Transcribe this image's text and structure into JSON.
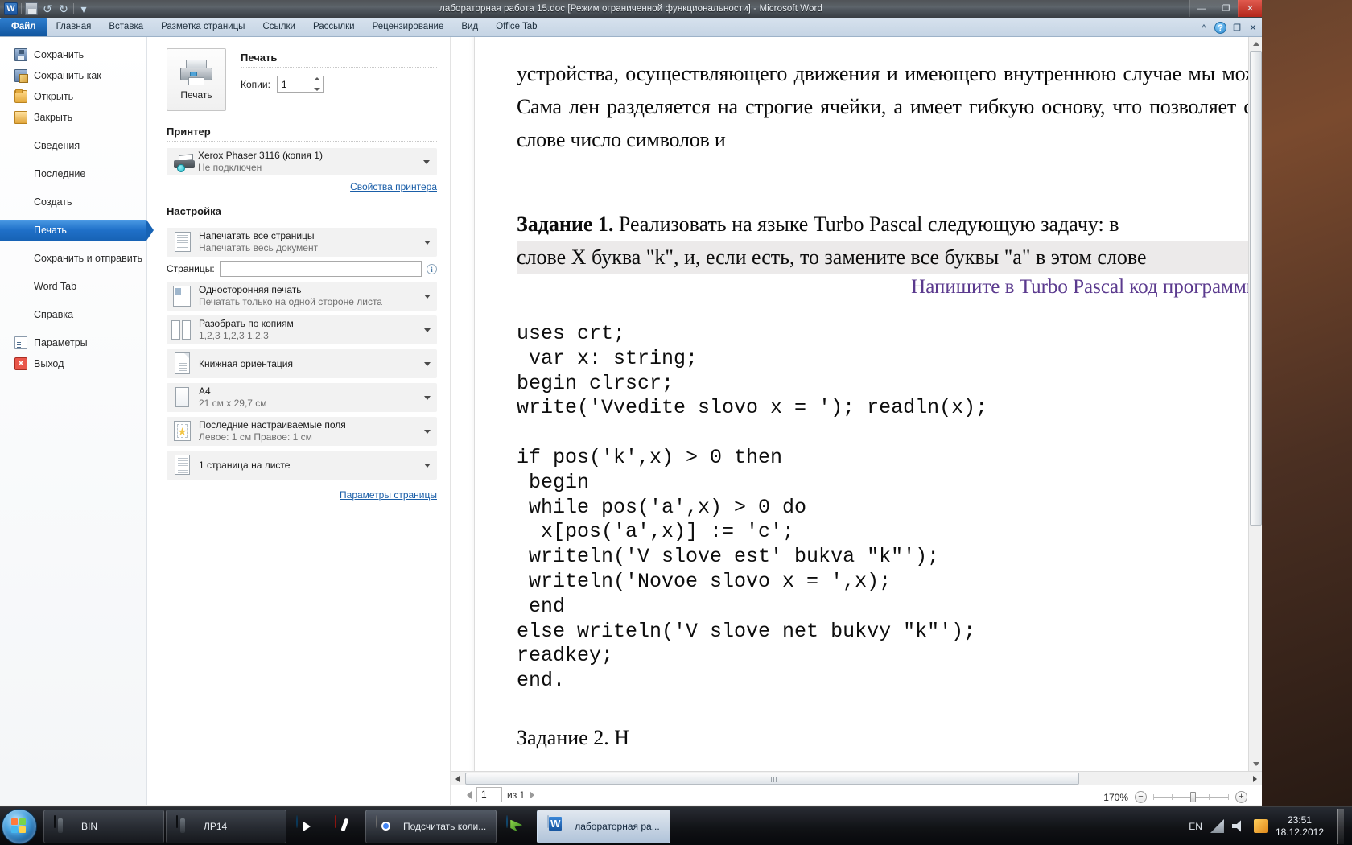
{
  "window": {
    "title": "лабораторная работа 15.doc [Режим ограниченной функциональности]  -  Microsoft Word",
    "qat": {
      "logo": "W",
      "save": "save-icon",
      "undo": "↺",
      "redo": "↻",
      "more": "▾"
    },
    "buttons": {
      "minimize": "—",
      "restore": "❐",
      "close": "✕"
    }
  },
  "ribbon": {
    "tabs": [
      {
        "label": "Файл",
        "selected": true
      },
      {
        "label": "Главная",
        "selected": false
      },
      {
        "label": "Вставка",
        "selected": false
      },
      {
        "label": "Разметка страницы",
        "selected": false
      },
      {
        "label": "Ссылки",
        "selected": false
      },
      {
        "label": "Рассылки",
        "selected": false
      },
      {
        "label": "Рецензирование",
        "selected": false
      },
      {
        "label": "Вид",
        "selected": false
      },
      {
        "label": "Office Tab",
        "selected": false
      }
    ],
    "help_label": "?",
    "minimize_ribbon": "^",
    "restore_window": "❐",
    "close_window": "✕"
  },
  "backstage": {
    "menu": [
      {
        "label": "Сохранить",
        "icon": "floppy-icon",
        "selected": false
      },
      {
        "label": "Сохранить как",
        "icon": "save-as-icon",
        "selected": false
      },
      {
        "label": "Открыть",
        "icon": "open-folder-icon",
        "selected": false
      },
      {
        "label": "Закрыть",
        "icon": "close-folder-icon",
        "selected": false
      },
      {
        "label": "Сведения",
        "icon": "",
        "selected": false
      },
      {
        "label": "Последние",
        "icon": "",
        "selected": false
      },
      {
        "label": "Создать",
        "icon": "",
        "selected": false
      },
      {
        "label": "Печать",
        "icon": "",
        "selected": true
      },
      {
        "label": "Сохранить и отправить",
        "icon": "",
        "selected": false
      },
      {
        "label": "Word Tab",
        "icon": "",
        "selected": false
      },
      {
        "label": "Справка",
        "icon": "",
        "selected": false
      },
      {
        "label": "Параметры",
        "icon": "options-icon",
        "selected": false
      },
      {
        "label": "Выход",
        "icon": "exit-icon",
        "selected": false
      }
    ]
  },
  "print": {
    "heading": "Печать",
    "button_label": "Печать",
    "copies_label": "Копии:",
    "copies_value": "1",
    "printer_heading": "Принтер",
    "printer_name": "Xerox Phaser 3116 (копия 1)",
    "printer_status": "Не подключен",
    "printer_properties_link": "Свойства принтера",
    "settings_heading": "Настройка",
    "page_setup_link": "Параметры страницы",
    "info_icon": "i",
    "options": [
      {
        "main": "Напечатать все страницы",
        "sub": "Напечатать весь документ",
        "icon": "pages-icon"
      },
      {
        "main": "Односторонняя печать",
        "sub": "Печатать только на одной стороне листа",
        "icon": "one-sided-icon"
      },
      {
        "main": "Разобрать по копиям",
        "sub": "1,2,3   1,2,3   1,2,3",
        "icon": "collate-icon"
      },
      {
        "main": "Книжная ориентация",
        "sub": "",
        "icon": "portrait-icon"
      },
      {
        "main": "A4",
        "sub": "21 см x 29,7 см",
        "icon": "paper-size-icon"
      },
      {
        "main": "Последние настраиваемые поля",
        "sub": "Левое: 1 см   Правое: 1 см",
        "icon": "margins-icon"
      },
      {
        "main": "1 страница на листе",
        "sub": "",
        "icon": "pages-per-sheet-icon"
      }
    ],
    "pages_label": "Страницы:",
    "pages_value": "",
    "pages_placeholder": ""
  },
  "preview": {
    "doc_paragraph": "устройства, осуществляющего движения и имеющего внутреннюю случае мы можем оперировать только ленточными знаками. Сама лен разделяется на строгие ячейки, а имеет гибкую основу, что позволяет сжиматься исходя из того, увеличивается ли в слове число символов и",
    "task_bold": "Задание 1.",
    "task_rest": " Реализовать на языке Turbo Pascal следующую задачу: в",
    "task_line2": "слове X буква \"k\", и, если есть, то замените все буквы \"a\" в этом слове",
    "purple_line": "Напишите в Turbo Pascal код программы.",
    "code": "uses crt;\n var x: string;\nbegin clrscr;\nwrite('Vvedite slovo x = '); readln(x);\n\nif pos('k',x) > 0 then\n begin\n while pos('a',x) > 0 do\n  x[pos('a',x)] := 'c';\n writeln('V slove est' bukva \"k\"');\n writeln('Novoe slovo x = ',x);\n end\nelse writeln('V slove net bukvy \"k\"');\nreadkey;\nend.",
    "tail_line": "Задание 2. Н",
    "page_current": "1",
    "page_of": "из 1",
    "zoom_value": "170%",
    "zoom_out": "−",
    "zoom_in": "+"
  },
  "taskbar": {
    "start": "start-orb",
    "items": [
      {
        "label": "BIN",
        "icon": "folder-stack-icon",
        "state": "grouped"
      },
      {
        "label": "ЛР14",
        "icon": "folder-stack-icon",
        "state": "grouped"
      },
      {
        "label": "",
        "icon": "media-player-icon",
        "state": "pinned"
      },
      {
        "label": "",
        "icon": "ccleaner-icon",
        "state": "pinned"
      },
      {
        "label": "Подсчитать коли...",
        "icon": "chrome-icon",
        "state": "running"
      },
      {
        "label": "",
        "icon": "download-master-icon",
        "state": "pinned"
      },
      {
        "label": "лабораторная ра...",
        "icon": "word-icon",
        "state": "active"
      }
    ],
    "tray": {
      "language": "EN",
      "network": "network-icon",
      "volume": "volume-icon",
      "flag": "action-center-icon",
      "time": "23:51",
      "date": "18.12.2012"
    }
  }
}
